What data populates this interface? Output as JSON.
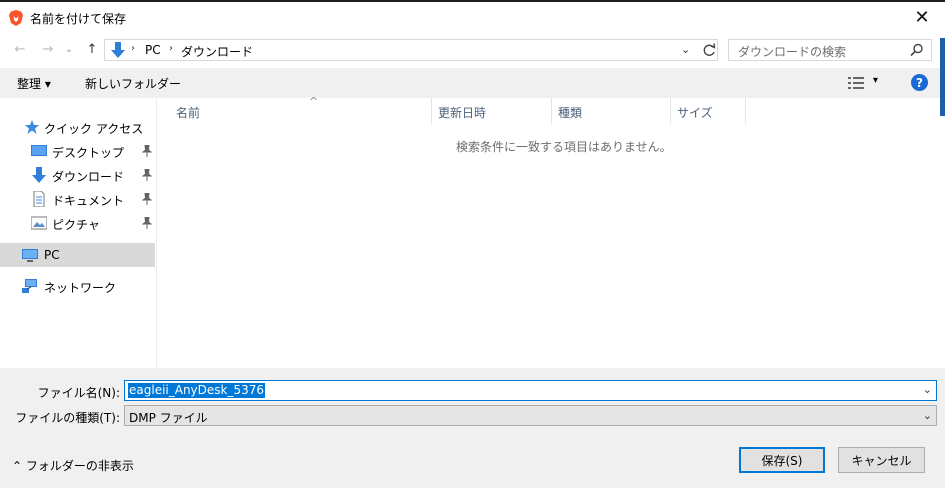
{
  "window": {
    "title": "名前を付けて保存",
    "close_glyph": "✕"
  },
  "nav_buttons": {
    "back": "←",
    "forward": "→",
    "dropdown": "⌄",
    "up": "↑"
  },
  "address": {
    "breadcrumbs": [
      "PC",
      "ダウンロード"
    ],
    "separator": "›",
    "dropdown_glyph": "⌄"
  },
  "search": {
    "placeholder": "ダウンロードの検索"
  },
  "toolbar": {
    "organize": "整理 ▾",
    "new_folder": "新しいフォルダー",
    "view_dropdown": "▾",
    "help": "?"
  },
  "nav_pane": {
    "items": [
      {
        "label": "クイック アクセス",
        "icon": "star-icon"
      },
      {
        "label": "デスクトップ",
        "icon": "desktop-icon",
        "pinned": true
      },
      {
        "label": "ダウンロード",
        "icon": "download-icon",
        "pinned": true
      },
      {
        "label": "ドキュメント",
        "icon": "document-icon",
        "pinned": true
      },
      {
        "label": "ピクチャ",
        "icon": "picture-icon",
        "pinned": true
      },
      {
        "label": "PC",
        "icon": "pc-icon",
        "selected": true
      },
      {
        "label": "ネットワーク",
        "icon": "network-icon"
      }
    ]
  },
  "columns": [
    "名前",
    "更新日時",
    "種類",
    "サイズ"
  ],
  "sort_indicator": "^",
  "empty_message": "検索条件に一致する項目はありません。",
  "file_name": {
    "label": "ファイル名(N):",
    "value": "eagleii_AnyDesk_5376",
    "dropdown_glyph": "⌄"
  },
  "file_type": {
    "label": "ファイルの種類(T):",
    "value": "DMP ファイル",
    "dropdown_glyph": "⌄"
  },
  "footer": {
    "hide_folders": "⌃  フォルダーの非表示",
    "save": "保存(S)",
    "cancel": "キャンセル"
  },
  "colors": {
    "accent": "#0078d7",
    "selected_row": "#d9d9d9",
    "toolbar_bg": "#f0f0f0"
  }
}
